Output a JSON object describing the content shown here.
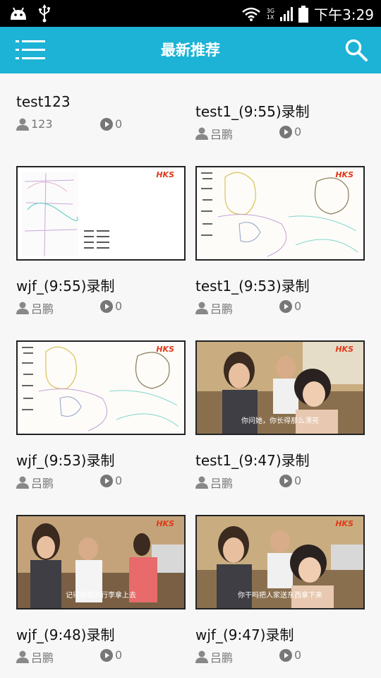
{
  "status_bar": {
    "network_top": "3G",
    "network_bottom": "1X",
    "time": "下午3:29"
  },
  "app_bar": {
    "title": "最新推荐"
  },
  "cards": [
    {
      "title": "test123",
      "author": "123",
      "plays": "0",
      "thumb": "none"
    },
    {
      "title": "test1_(9:55)录制",
      "author": "吕鹏",
      "plays": "0",
      "thumb": "none"
    },
    {
      "title": "wjf_(9:55)录制",
      "author": "吕鹏",
      "plays": "0",
      "thumb": "credits",
      "logo": "HKS"
    },
    {
      "title": "test1_(9:53)录制",
      "author": "吕鹏",
      "plays": "0",
      "thumb": "sketch",
      "logo": "HKS"
    },
    {
      "title": "wjf_(9:53)录制",
      "author": "吕鹏",
      "plays": "0",
      "thumb": "sketch",
      "logo": "HKS"
    },
    {
      "title": "test1_(9:47)录制",
      "author": "吕鹏",
      "plays": "0",
      "thumb": "scene",
      "logo": "HKS",
      "subtitle": "你问她，你长得那么漂亮"
    },
    {
      "title": "wjf_(9:48)录制",
      "author": "吕鹏",
      "plays": "0",
      "thumb": "scene",
      "logo": "HKS",
      "subtitle": "记得把我的行李拿上去"
    },
    {
      "title": "wjf_(9:47)录制",
      "author": "吕鹏",
      "plays": "0",
      "thumb": "scene",
      "logo": "HKS",
      "subtitle": "你干吗把人家送东西拿下来"
    }
  ],
  "colors": {
    "accent": "#1cb3d6",
    "statusbar": "#000000",
    "background": "#f7f7f7",
    "logo": "#e03a1a"
  },
  "icons": {
    "menu": "menu-icon",
    "search": "search-icon",
    "author": "person-icon",
    "plays": "play-circle-icon"
  }
}
